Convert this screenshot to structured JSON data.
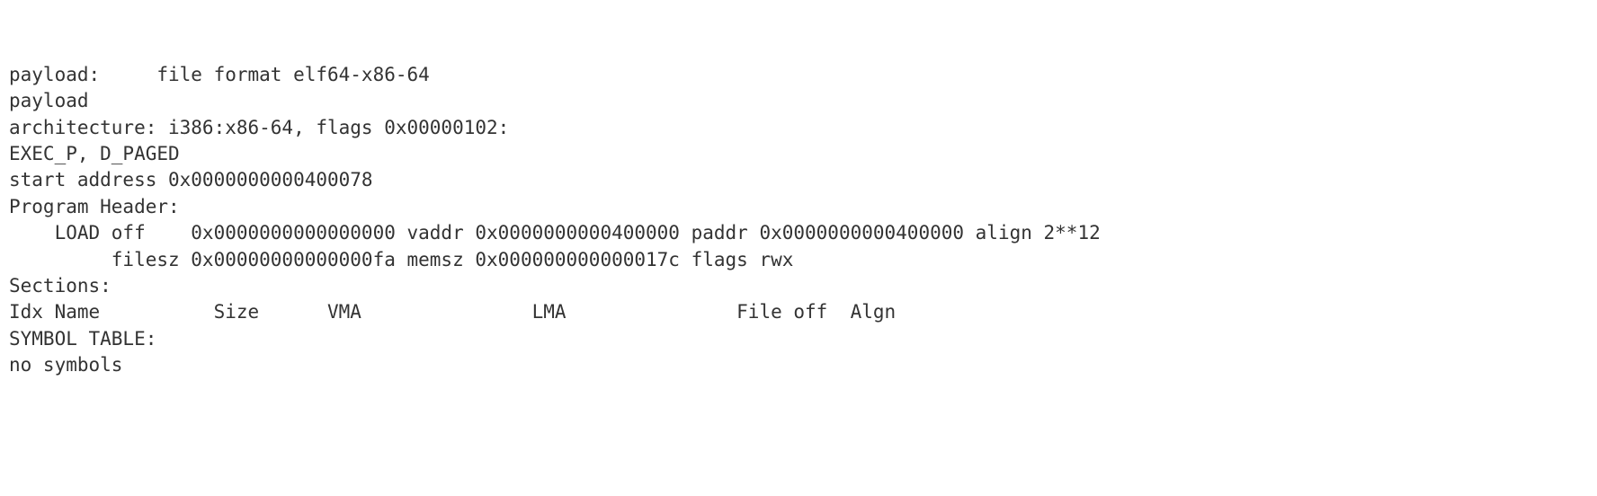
{
  "lines": {
    "l1": "payload:     file format elf64-x86-64",
    "l2": "payload",
    "l3": "architecture: i386:x86-64, flags 0x00000102:",
    "l4": "EXEC_P, D_PAGED",
    "l5": "start address 0x0000000000400078",
    "l6": "",
    "l7": "Program Header:",
    "l8": "    LOAD off    0x0000000000000000 vaddr 0x0000000000400000 paddr 0x0000000000400000 align 2**12",
    "l9": "         filesz 0x00000000000000fa memsz 0x000000000000017c flags rwx",
    "l10": "",
    "l11": "Sections:",
    "l12": "Idx Name          Size      VMA               LMA               File off  Algn",
    "l13": "SYMBOL TABLE:",
    "l14": "no symbols"
  }
}
